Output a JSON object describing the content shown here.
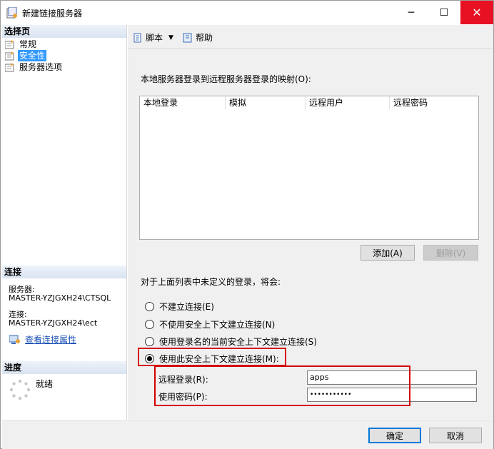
{
  "window": {
    "title": "新建链接服务器",
    "minimize_symbol": "─",
    "maximize_symbol": "☐",
    "close_symbol": "✕"
  },
  "left_panel": {
    "select_page_header": "选择页",
    "pages": [
      {
        "label": "常规",
        "icon": "page-icon"
      },
      {
        "label": "安全性",
        "icon": "page-icon",
        "selected": true
      },
      {
        "label": "服务器选项",
        "icon": "page-icon"
      }
    ],
    "connection_header": "连接",
    "server_label": "服务器:",
    "server_value": "MASTER-YZJGXH24\\CTSQL",
    "connection_label": "连接:",
    "connection_value": "MASTER-YZJGXH24\\ect",
    "view_connection_properties": "查看连接属性",
    "progress_header": "进度",
    "progress_status": "就绪"
  },
  "toolbar": {
    "script_label": "脚本",
    "help_label": "帮助"
  },
  "main": {
    "mapping_label": "本地服务器登录到远程服务器登录的映射(O):",
    "grid_columns": [
      "本地登录",
      "模拟",
      "远程用户",
      "远程密码"
    ],
    "grid_rows": [],
    "add_button": "添加(A)",
    "delete_button": "删除(V)",
    "undefined_logins_label": "对于上面列表中未定义的登录，将会:",
    "options": [
      {
        "label": "不建立连接(E)",
        "checked": false
      },
      {
        "label": "不使用安全上下文建立连接(N)",
        "checked": false
      },
      {
        "label": "使用登录名的当前安全上下文建立连接(S)",
        "checked": false
      },
      {
        "label": "使用此安全上下文建立连接(M):",
        "checked": true
      }
    ],
    "remote_login_label": "远程登录(R):",
    "remote_login_value": "apps",
    "password_label": "使用密码(P):",
    "password_value": "•••••••••••"
  },
  "footer": {
    "ok_button": "确定",
    "cancel_button": "取消"
  },
  "colors": {
    "accent": "#0078d7",
    "highlight_box": "#d40000",
    "selection": "#3399ff",
    "close_button": "#e81123"
  }
}
